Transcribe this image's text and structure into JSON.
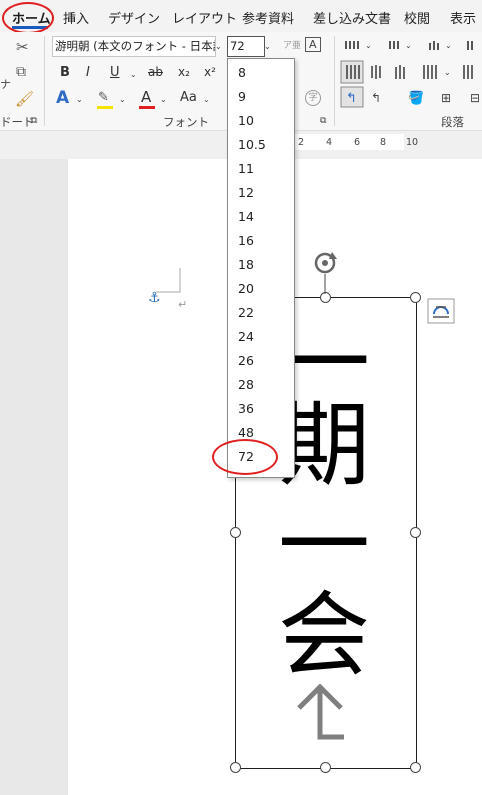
{
  "tabs": [
    "ホーム",
    "挿入",
    "デザイン",
    "レイアウト",
    "参考資料",
    "差し込み文書",
    "校閲",
    "表示"
  ],
  "font": {
    "name": "游明朝 (本文のフォント - 日本語)",
    "size": "72"
  },
  "ribbon": {
    "clipboard_fragment": "ドード",
    "font_group_label": "フォント",
    "paragraph_group_label": "段落",
    "format_labels": {
      "bold": "B",
      "italic": "I",
      "underline": "U",
      "strike": "ab",
      "sub": "x₂",
      "sup": "x²",
      "case": "Aa",
      "A": "A"
    }
  },
  "ruler": [
    "2",
    "4",
    "6",
    "8",
    "10"
  ],
  "font_size_options": [
    "8",
    "9",
    "10",
    "10.5",
    "11",
    "12",
    "14",
    "16",
    "18",
    "20",
    "22",
    "24",
    "26",
    "28",
    "36",
    "48",
    "72"
  ],
  "document": {
    "vertical_text": [
      "一",
      "期",
      "一",
      "会"
    ]
  },
  "colors": {
    "accent_blue": "#185abd",
    "annotation_red": "#e02020",
    "font_color_underline": "#e02020",
    "highlight": "#f5e400"
  }
}
